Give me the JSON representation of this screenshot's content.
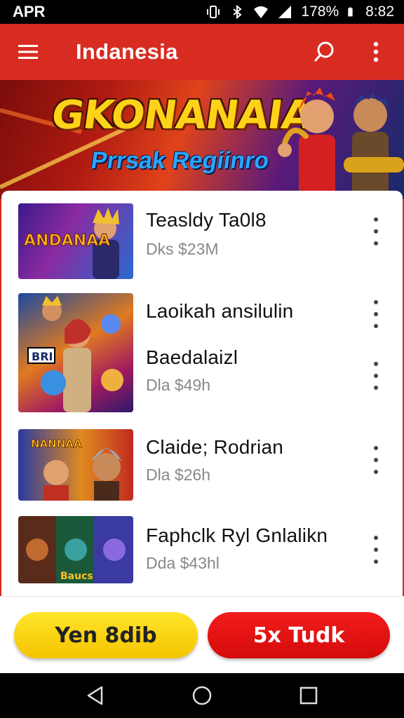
{
  "status_bar": {
    "left_text": "APR",
    "battery_text": "178%",
    "time": "8:82"
  },
  "app_bar": {
    "title": "Indanesia",
    "menu_icon": "hamburger-menu-icon",
    "search_icon": "search-icon",
    "more_icon": "more-vertical-icon"
  },
  "banner": {
    "title": "GKONANAIA",
    "subtitle": "Prrsak Regiinro"
  },
  "list": {
    "items": [
      {
        "title": "Teasldy Ta0l8",
        "subtitle": "Dks $23M"
      },
      {
        "title": "Laoikah ansilulin",
        "subtitle": ""
      },
      {
        "title": "Baedalaizl",
        "subtitle": "Dla $49h"
      },
      {
        "title": "Claide; Rodrian",
        "subtitle": "Dla $26h"
      },
      {
        "title": "Faphclk Ryl Gnlalikn",
        "subtitle": "Dda $43hl"
      }
    ],
    "thumb_labels": [
      "ANDANAA",
      "BRI",
      "NANNAA",
      "Baucs"
    ]
  },
  "actions": {
    "primary_label": "Yen 8dib",
    "secondary_label": "5x Tudk"
  },
  "colors": {
    "brand_red": "#d82c23",
    "button_yellow": "#f5c400",
    "button_red": "#e01212"
  }
}
